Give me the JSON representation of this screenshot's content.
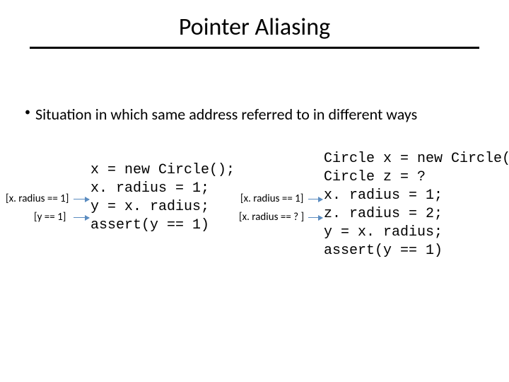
{
  "title": "Pointer Aliasing",
  "bullet": "Situation in which same address referred to in different ways",
  "code_left": "x = new Circle();\nx. radius = 1;\ny = x. radius;\nassert(y == 1)",
  "code_right": "Circle x = new Circle();\nCircle z = ?\nx. radius = 1;\nz. radius = 2;\ny = x. radius;\nassert(y == 1)",
  "annotations": {
    "left1": "[x. radius == 1]",
    "left2": "[y == 1]",
    "right1": "[x. radius == 1]",
    "right2": "[x. radius == ? ]"
  }
}
